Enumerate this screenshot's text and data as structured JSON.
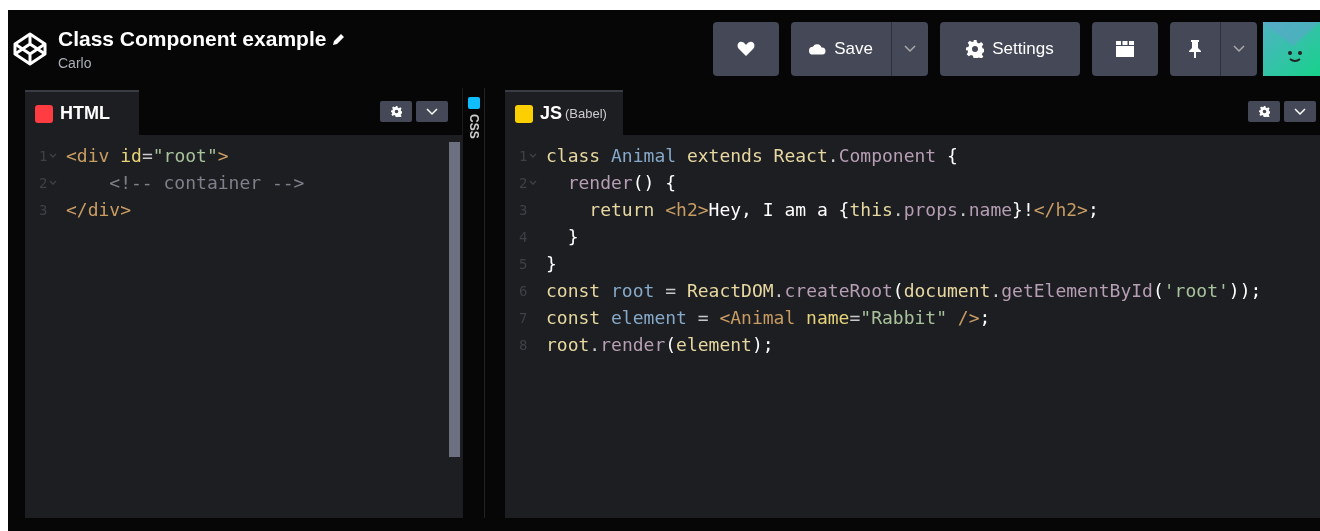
{
  "header": {
    "title": "Class Component example",
    "author": "Carlo",
    "save_label": "Save",
    "settings_label": "Settings"
  },
  "editors": [
    {
      "label": "HTML",
      "color": "#ff3c41",
      "lines": [
        {
          "number": "1",
          "fold": true,
          "tokens": [
            {
              "text": "<div ",
              "kind": "tag"
            },
            {
              "text": "id",
              "kind": "attr"
            },
            {
              "text": "=",
              "kind": "plain"
            },
            {
              "text": "\"root\"",
              "kind": "string"
            },
            {
              "text": ">",
              "kind": "tag"
            }
          ]
        },
        {
          "number": "2",
          "fold": true,
          "tokens": [
            {
              "text": "    <!-- container -->",
              "kind": "comment"
            }
          ]
        },
        {
          "number": "3",
          "fold": false,
          "tokens": [
            {
              "text": "</div>",
              "kind": "tag"
            }
          ]
        }
      ]
    },
    {
      "label": "JS",
      "note": "(Babel)",
      "color": "#fcd000",
      "lines": [
        {
          "number": "1",
          "fold": true,
          "tokens": [
            {
              "text": "class ",
              "kind": "keyword"
            },
            {
              "text": "Animal",
              "kind": "def"
            },
            {
              "text": " extends ",
              "kind": "keyword"
            },
            {
              "text": "React",
              "kind": "keyword"
            },
            {
              "text": ".",
              "kind": "plain"
            },
            {
              "text": "Component",
              "kind": "property"
            },
            {
              "text": " {",
              "kind": "bright"
            }
          ]
        },
        {
          "number": "2",
          "fold": true,
          "tokens": [
            {
              "text": "  render",
              "kind": "property"
            },
            {
              "text": "() {",
              "kind": "bright"
            }
          ]
        },
        {
          "number": "3",
          "fold": false,
          "tokens": [
            {
              "text": "    return ",
              "kind": "keyword"
            },
            {
              "text": "<h2>",
              "kind": "tag"
            },
            {
              "text": "Hey, I am a {",
              "kind": "bright"
            },
            {
              "text": "this",
              "kind": "keyword"
            },
            {
              "text": ".",
              "kind": "plain"
            },
            {
              "text": "props",
              "kind": "property"
            },
            {
              "text": ".",
              "kind": "plain"
            },
            {
              "text": "name",
              "kind": "property"
            },
            {
              "text": "}!",
              "kind": "bright"
            },
            {
              "text": "</h2>",
              "kind": "tag"
            },
            {
              "text": ";",
              "kind": "bright"
            }
          ]
        },
        {
          "number": "4",
          "fold": false,
          "tokens": [
            {
              "text": "  }",
              "kind": "bright"
            }
          ]
        },
        {
          "number": "5",
          "fold": false,
          "tokens": [
            {
              "text": "}",
              "kind": "bright"
            }
          ]
        },
        {
          "number": "6",
          "fold": false,
          "tokens": [
            {
              "text": "const ",
              "kind": "keyword"
            },
            {
              "text": "root",
              "kind": "def"
            },
            {
              "text": " = ",
              "kind": "plain"
            },
            {
              "text": "ReactDOM",
              "kind": "keyword"
            },
            {
              "text": ".",
              "kind": "plain"
            },
            {
              "text": "createRoot",
              "kind": "property"
            },
            {
              "text": "(",
              "kind": "bright"
            },
            {
              "text": "document",
              "kind": "keyword"
            },
            {
              "text": ".",
              "kind": "plain"
            },
            {
              "text": "getElementById",
              "kind": "property"
            },
            {
              "text": "(",
              "kind": "bright"
            },
            {
              "text": "'root'",
              "kind": "string"
            },
            {
              "text": "));",
              "kind": "bright"
            }
          ]
        },
        {
          "number": "7",
          "fold": false,
          "tokens": [
            {
              "text": "const ",
              "kind": "keyword"
            },
            {
              "text": "element",
              "kind": "def"
            },
            {
              "text": " = ",
              "kind": "plain"
            },
            {
              "text": "<Animal ",
              "kind": "tag"
            },
            {
              "text": "name",
              "kind": "attr"
            },
            {
              "text": "=",
              "kind": "plain"
            },
            {
              "text": "\"Rabbit\"",
              "kind": "string"
            },
            {
              "text": " />",
              "kind": "tag"
            },
            {
              "text": ";",
              "kind": "bright"
            }
          ]
        },
        {
          "number": "8",
          "fold": false,
          "tokens": [
            {
              "text": "root",
              "kind": "keyword"
            },
            {
              "text": ".",
              "kind": "plain"
            },
            {
              "text": "render",
              "kind": "property"
            },
            {
              "text": "(",
              "kind": "bright"
            },
            {
              "text": "element",
              "kind": "keyword"
            },
            {
              "text": ");",
              "kind": "bright"
            }
          ]
        }
      ]
    }
  ],
  "collapsed_editor": {
    "label": "CSS",
    "color": "#0ebeff"
  }
}
